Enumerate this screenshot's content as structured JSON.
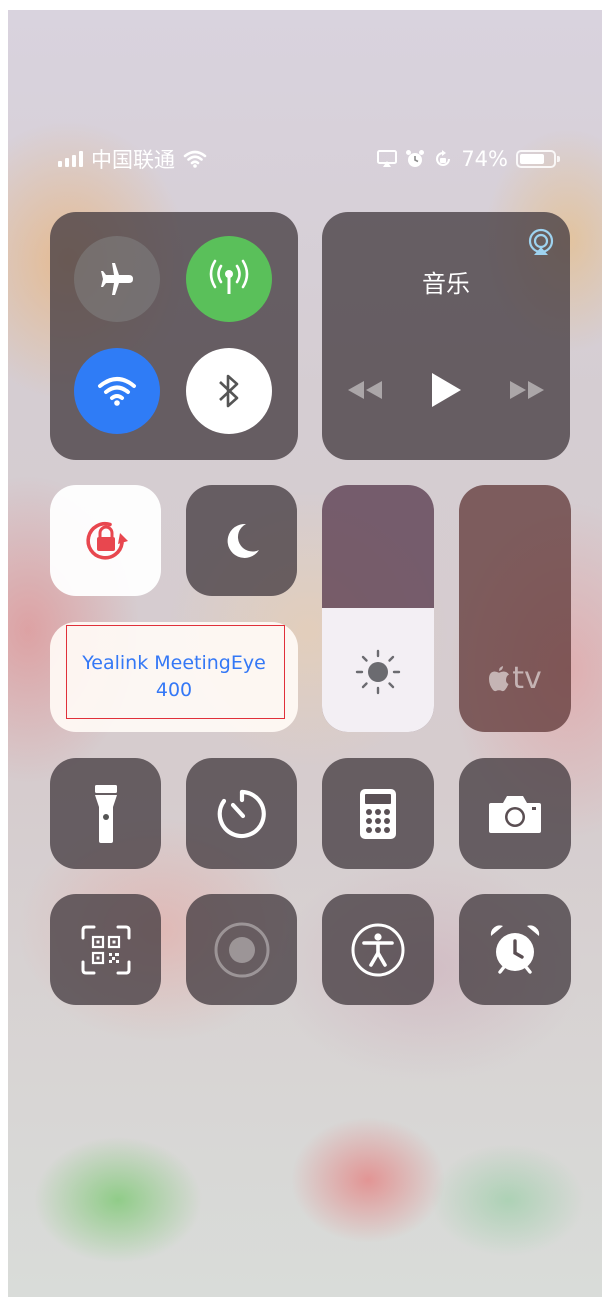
{
  "status_bar": {
    "carrier": "中国联通",
    "battery_percent": "74%",
    "battery_level": 0.74,
    "icons": [
      "cellular-signal-icon",
      "wifi-icon",
      "screen-mirroring-icon",
      "alarm-icon",
      "orientation-lock-icon",
      "battery-icon"
    ]
  },
  "connectivity": {
    "airplane_mode": {
      "icon": "airplane-icon",
      "on": false
    },
    "cellular_data": {
      "icon": "antenna-icon",
      "on": true,
      "color": "#5ac05a"
    },
    "wifi": {
      "icon": "wifi-icon",
      "on": true,
      "color": "#2f7cf6"
    },
    "bluetooth": {
      "icon": "bluetooth-icon",
      "on": true
    }
  },
  "music": {
    "title": "音乐",
    "icons": [
      "airplay-audio-icon",
      "previous-track-icon",
      "play-icon",
      "next-track-icon"
    ]
  },
  "orientation_lock": {
    "icon": "orientation-lock-icon",
    "on": true,
    "color": "#e8474f"
  },
  "do_not_disturb": {
    "icon": "moon-icon",
    "on": false
  },
  "screen_mirroring": {
    "line1": "Yealink MeetingEye",
    "line2": "400",
    "color": "#3478f6"
  },
  "brightness": {
    "icon": "sun-icon",
    "level": 0.5
  },
  "apple_tv_remote": {
    "label": "tv",
    "icon": "apple-logo-icon"
  },
  "row_three": [
    "flashlight-icon",
    "timer-icon",
    "calculator-icon",
    "camera-icon"
  ],
  "row_four": [
    "qr-scanner-icon",
    "screen-record-icon",
    "accessibility-icon",
    "alarm-clock-icon"
  ]
}
